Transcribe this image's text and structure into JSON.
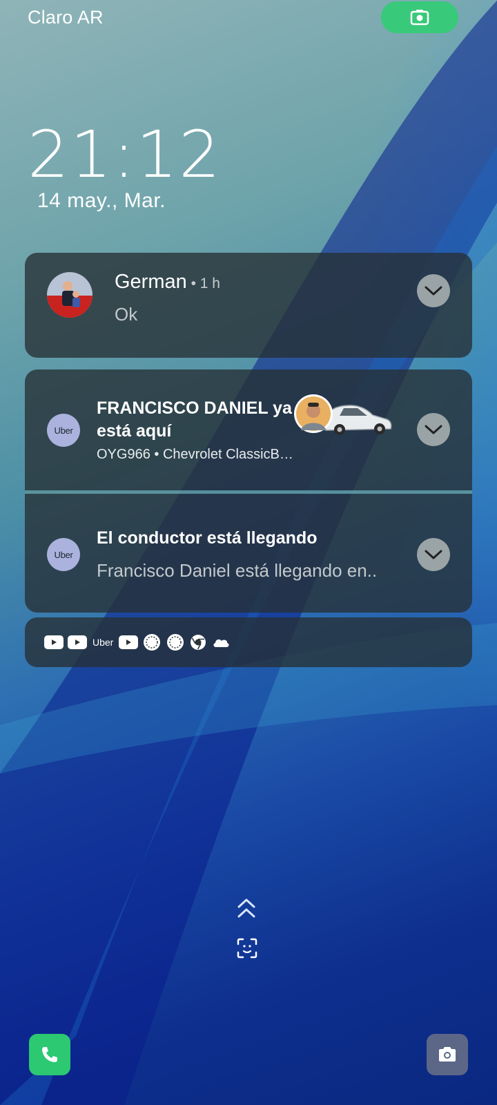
{
  "status_bar": {
    "carrier": "Claro AR",
    "recording_indicator_icon": "screen-record-icon"
  },
  "lockscreen": {
    "time": "21:12",
    "date": "14 may., Mar."
  },
  "notifications": [
    {
      "sender": "German",
      "time": " • 1 h",
      "message": "Ok",
      "avatar_icon": "contact-photo"
    },
    {
      "app_badge": "Uber",
      "title": "FRANCISCO DANIEL ya está aquí",
      "subtitle": "OYG966 • Chevrolet ClassicB…",
      "image": "driver-and-car-photo"
    },
    {
      "app_badge": "Uber",
      "title": "El conductor está llegando",
      "message": "Francisco Daniel está llegando en.."
    }
  ],
  "notification_icons": {
    "items": [
      "youtube-icon",
      "youtube-icon",
      "Uber",
      "youtube-icon",
      "sun-icon",
      "sun-icon",
      "chrome-icon",
      "cloud-icon"
    ]
  },
  "bottom": {
    "swipe_icon": "double-chevron-up-icon",
    "face_unlock_icon": "face-scan-icon",
    "left_shortcut_icon": "phone-icon",
    "right_shortcut_icon": "camera-icon"
  },
  "colors": {
    "record_pill": "#38c97a",
    "phone_button": "#2cc872",
    "camera_button": "#5c6788",
    "uber_badge": "#aab2dd"
  }
}
